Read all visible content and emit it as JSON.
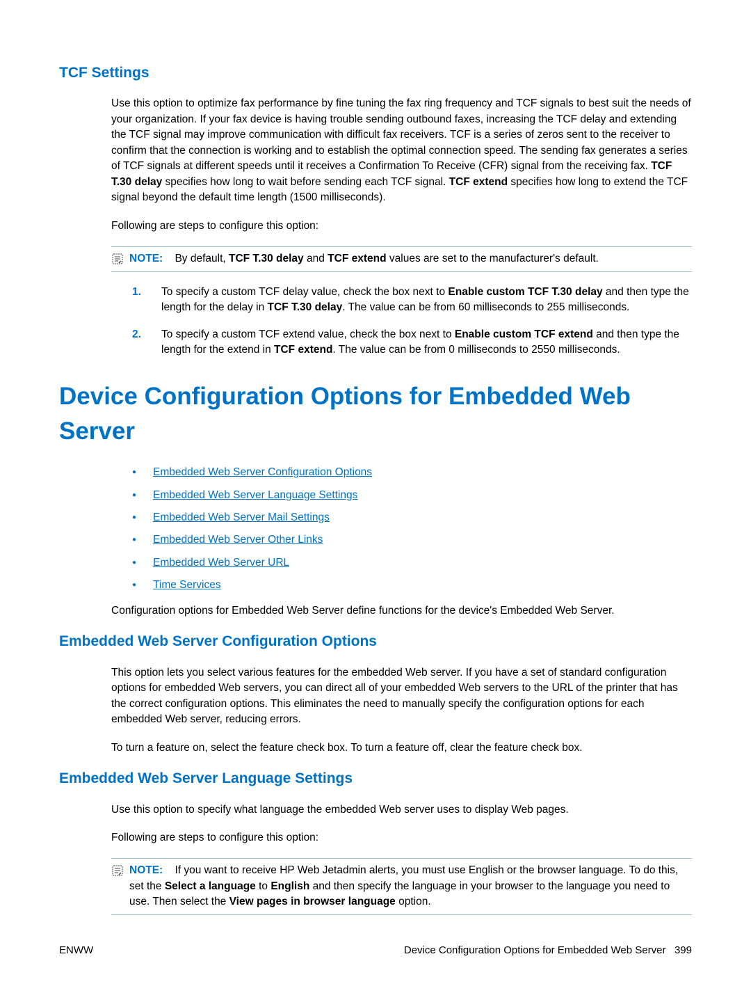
{
  "section1": {
    "title": "TCF Settings",
    "para1_prefix": "Use this option to optimize fax performance by fine tuning the fax ring frequency and TCF signals to best suit the needs of your organization. If your fax device is having trouble sending outbound faxes, increasing the TCF delay and extending the TCF signal may improve communication with difficult fax receivers. TCF is a series of zeros sent to the receiver to confirm that the connection is working and to establish the optimal connection speed. The sending fax generates a series of TCF signals at different speeds until it receives a Confirmation To Receive (CFR) signal from the receiving fax. ",
    "para1_bold1": "TCF T.30 delay",
    "para1_mid": " specifies how long to wait before sending each TCF signal. ",
    "para1_bold2": "TCF extend",
    "para1_suffix": " specifies how long to extend the TCF signal beyond the default time length (1500 milliseconds).",
    "para2": "Following are steps to configure this option:",
    "note_label": "NOTE:",
    "note_prefix": "By default, ",
    "note_bold1": "TCF T.30 delay",
    "note_mid": " and ",
    "note_bold2": "TCF extend",
    "note_suffix": " values are set to the manufacturer's default.",
    "step1_prefix": "To specify a custom TCF delay value, check the box next to ",
    "step1_bold1": "Enable custom TCF T.30 delay",
    "step1_mid": " and then type the length for the delay in ",
    "step1_bold2": "TCF T.30 delay",
    "step1_suffix": ". The value can be from 60 milliseconds to 255 milliseconds.",
    "step2_prefix": "To specify a custom TCF extend value, check the box next to ",
    "step2_bold1": "Enable custom TCF extend",
    "step2_mid": " and then type the length for the extend in ",
    "step2_bold2": "TCF extend",
    "step2_suffix": ". The value can be from 0 milliseconds to 2550 milliseconds."
  },
  "section2": {
    "title": "Device Configuration Options for Embedded Web Server",
    "links": [
      "Embedded Web Server Configuration Options",
      "Embedded Web Server Language Settings",
      "Embedded Web Server Mail Settings",
      "Embedded Web Server Other Links",
      "Embedded Web Server URL",
      "Time Services"
    ],
    "para": "Configuration options for Embedded Web Server define functions for the device's Embedded Web Server."
  },
  "section3": {
    "title": "Embedded Web Server Configuration Options",
    "para1": "This option lets you select various features for the embedded Web server. If you have a set of standard configuration options for embedded Web servers, you can direct all of your embedded Web servers to the URL of the printer that has the correct configuration options. This eliminates the need to manually specify the configuration options for each embedded Web server, reducing errors.",
    "para2": "To turn a feature on, select the feature check box. To turn a feature off, clear the feature check box."
  },
  "section4": {
    "title": "Embedded Web Server Language Settings",
    "para1": "Use this option to specify what language the embedded Web server uses to display Web pages.",
    "para2": "Following are steps to configure this option:",
    "note_label": "NOTE:",
    "note_prefix": "If you want to receive HP Web Jetadmin alerts, you must use English or the browser language. To do this, set the ",
    "note_bold1": "Select a language",
    "note_mid1": " to ",
    "note_bold2": "English",
    "note_mid2": " and then specify the language in your browser to the language you need to use. Then select the ",
    "note_bold3": "View pages in browser language",
    "note_suffix": " option."
  },
  "footer": {
    "left": "ENWW",
    "right_text": "Device Configuration Options for Embedded Web Server",
    "right_page": "399"
  }
}
